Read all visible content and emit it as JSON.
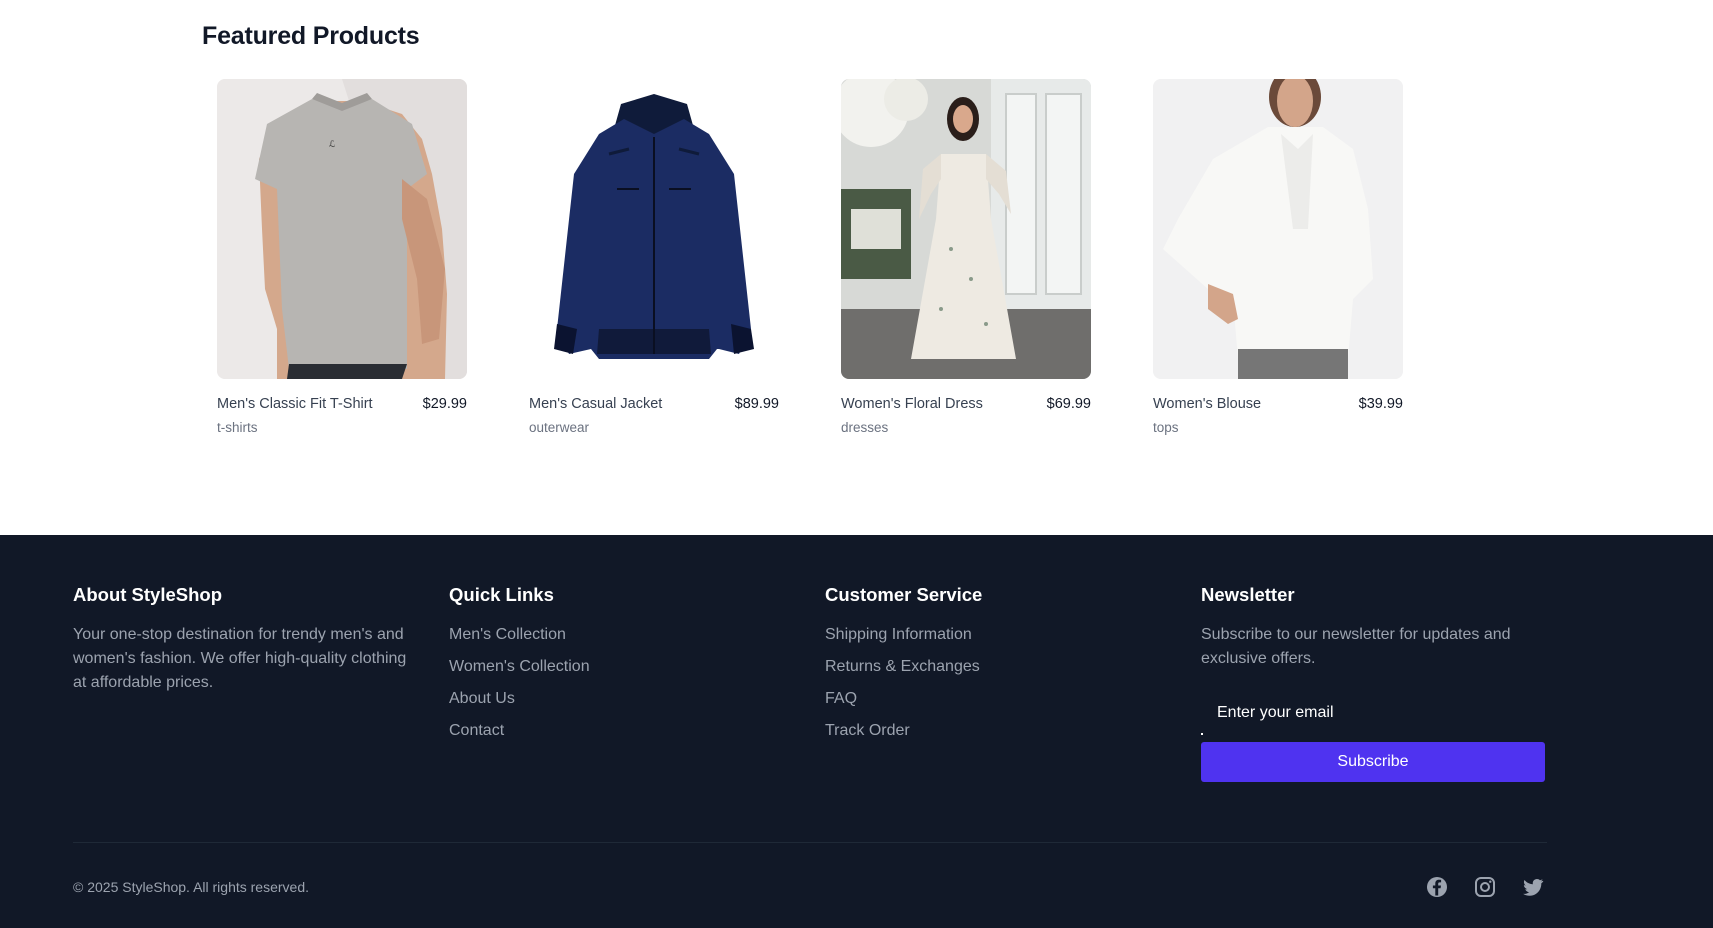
{
  "featured": {
    "title": "Featured Products",
    "products": [
      {
        "name": "Men's Classic Fit T-Shirt",
        "price": "$29.99",
        "category": "t-shirts",
        "image_icon": "tshirt-product-image"
      },
      {
        "name": "Men's Casual Jacket",
        "price": "$89.99",
        "category": "outerwear",
        "image_icon": "jacket-product-image"
      },
      {
        "name": "Women's Floral Dress",
        "price": "$69.99",
        "category": "dresses",
        "image_icon": "dress-product-image"
      },
      {
        "name": "Women's Blouse",
        "price": "$39.99",
        "category": "tops",
        "image_icon": "blouse-product-image"
      }
    ]
  },
  "footer": {
    "about": {
      "heading": "About StyleShop",
      "text": "Your one-stop destination for trendy men's and women's fashion. We offer high-quality clothing at affordable prices."
    },
    "quick_links": {
      "heading": "Quick Links",
      "items": [
        "Men's Collection",
        "Women's Collection",
        "About Us",
        "Contact"
      ]
    },
    "customer_service": {
      "heading": "Customer Service",
      "items": [
        "Shipping Information",
        "Returns & Exchanges",
        "FAQ",
        "Track Order"
      ]
    },
    "newsletter": {
      "heading": "Newsletter",
      "text": "Subscribe to our newsletter for updates and exclusive offers.",
      "input_placeholder": "Enter your email",
      "input_value": "",
      "button_label": "Subscribe"
    },
    "copyright": "© 2025 StyleShop. All rights reserved.",
    "social": [
      "facebook-icon",
      "instagram-icon",
      "twitter-icon"
    ]
  },
  "colors": {
    "footer_bg": "#111827",
    "accent": "#4f33f0",
    "muted_text": "#9ca3af"
  }
}
